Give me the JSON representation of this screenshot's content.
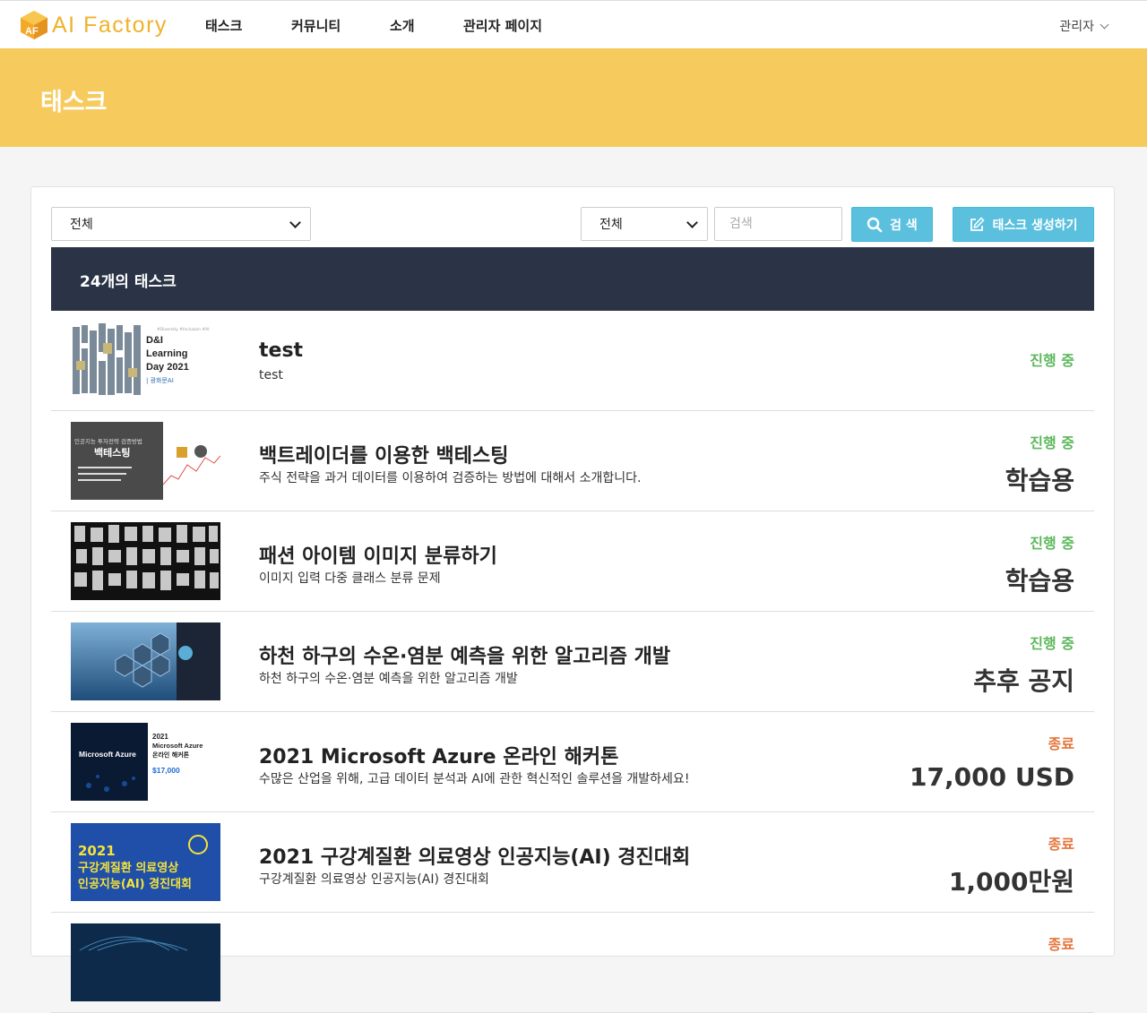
{
  "nav": {
    "logo_text": "AI Factory",
    "logo_mark": "AF",
    "items": [
      {
        "label": "태스크"
      },
      {
        "label": "커뮤니티"
      },
      {
        "label": "소개"
      },
      {
        "label": "관리자 페이지"
      }
    ],
    "user_label": "관리자"
  },
  "banner": {
    "title": "태스크"
  },
  "filters": {
    "category_selected": "전체",
    "search_field_selected": "전체",
    "search_placeholder": "검색",
    "search_button": "검 색",
    "create_button": "태스크 생성하기"
  },
  "count_label": "24개의 태스크",
  "tasks": [
    {
      "title": "test",
      "desc": "test",
      "status": "진행 중",
      "prize": "",
      "thumb_text": {
        "tag": "#Diversity #Inclusion #AI",
        "line1": "D&I",
        "line2": "Learning",
        "line3": "Day 2021",
        "line4": "| 광화문AI"
      }
    },
    {
      "title": "백트레이더를 이용한 백테스팅",
      "desc": "주식 전략을 과거 데이터를 이용하여 검증하는 방법에 대해서 소개합니다.",
      "status": "진행 중",
      "prize": "학습용",
      "thumb_text": {
        "line1": "인공지능 투자전략 검증방법",
        "line2": "백테스팅"
      }
    },
    {
      "title": "패션 아이템 이미지 분류하기",
      "desc": "이미지 입력 다중 클래스 분류 문제",
      "status": "진행 중",
      "prize": "학습용"
    },
    {
      "title": "하천 하구의 수온·염분 예측을 위한 알고리즘 개발",
      "desc": "하천 하구의 수온·염분 예측을 위한 알고리즘 개발",
      "status": "진행 중",
      "prize": "추후 공지"
    },
    {
      "title": "2021 Microsoft Azure 온라인 해커톤",
      "desc": "수많은 산업을 위해, 고급 데이터 분석과 AI에 관한 혁신적인 솔루션을 개발하세요!",
      "status": "종료",
      "prize": "17,000 USD",
      "thumb_text": {
        "line1": "Microsoft Azure",
        "line2": "2021",
        "line3": "Microsoft Azure",
        "line4": "온라인 해커톤",
        "line5": "$17,000"
      }
    },
    {
      "title": "2021 구강계질환 의료영상 인공지능(AI) 경진대회",
      "desc": "구강계질환 의료영상 인공지능(AI) 경진대회",
      "status": "종료",
      "prize": "1,000만원",
      "thumb_text": {
        "line1": "2021",
        "line2": "구강계질환 의료영상",
        "line3": "인공지능(AI) 경진대회"
      }
    },
    {
      "title": "",
      "desc": "",
      "status": "종료",
      "prize": ""
    }
  ],
  "colors": {
    "brand": "#efb22a",
    "banner": "#f6ca5c",
    "count_bar": "#2b3446",
    "button": "#5bc0de",
    "status_active": "#5cb85c",
    "status_ended": "#e5743b"
  },
  "icons": {
    "search": "search-icon",
    "edit": "edit-icon",
    "dropdown": "chevron-down-icon"
  }
}
